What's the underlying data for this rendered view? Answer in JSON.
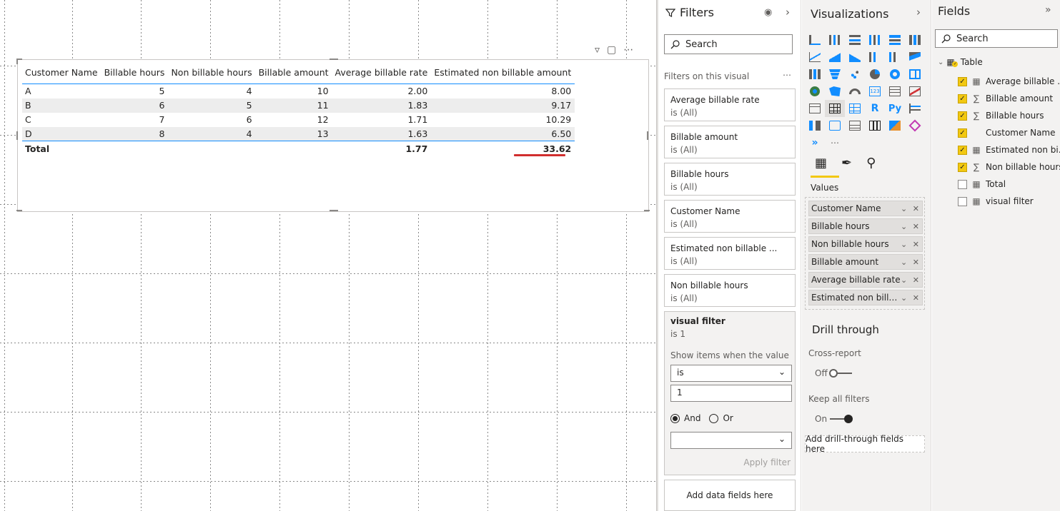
{
  "table": {
    "headers": [
      "Customer Name",
      "Billable hours",
      "Non billable hours",
      "Billable amount",
      "Average billable rate",
      "Estimated non billable amount"
    ],
    "rows": [
      [
        "A",
        "5",
        "4",
        "10",
        "2.00",
        "8.00"
      ],
      [
        "B",
        "6",
        "5",
        "11",
        "1.83",
        "9.17"
      ],
      [
        "C",
        "7",
        "6",
        "12",
        "1.71",
        "10.29"
      ],
      [
        "D",
        "8",
        "4",
        "13",
        "1.63",
        "6.50"
      ]
    ],
    "total": [
      "Total",
      "",
      "",
      "",
      "1.77",
      "33.62"
    ]
  },
  "filters": {
    "title": "Filters",
    "search_placeholder": "Search",
    "section_label": "Filters on this visual",
    "cards": [
      {
        "name": "Average billable rate",
        "state": "is (All)"
      },
      {
        "name": "Billable amount",
        "state": "is (All)"
      },
      {
        "name": "Billable hours",
        "state": "is (All)"
      },
      {
        "name": "Customer Name",
        "state": "is (All)"
      },
      {
        "name": "Estimated non billable ...",
        "state": "is (All)"
      },
      {
        "name": "Non billable hours",
        "state": "is (All)"
      }
    ],
    "visual_filter": {
      "name": "visual filter",
      "state": "is 1",
      "show_label": "Show items when the value",
      "operator": "is",
      "value": "1",
      "and_label": "And",
      "or_label": "Or",
      "apply_label": "Apply filter"
    },
    "add_fields": "Add data fields here"
  },
  "visualizations": {
    "title": "Visualizations",
    "values_label": "Values",
    "wells": [
      "Customer Name",
      "Billable hours",
      "Non billable hours",
      "Billable amount",
      "Average billable rate",
      "Estimated non billabl..."
    ],
    "drill_title": "Drill through",
    "cross_report": "Cross-report",
    "cross_report_state": "Off",
    "keep_filters": "Keep all filters",
    "keep_filters_state": "On",
    "add_drill": "Add drill-through fields here",
    "accent_color": "#f2c811"
  },
  "fields": {
    "title": "Fields",
    "search_placeholder": "Search",
    "table_name": "Table",
    "items": [
      {
        "name": "Average billable ...",
        "checked": true,
        "icon": "calculator"
      },
      {
        "name": "Billable amount",
        "checked": true,
        "icon": "sigma"
      },
      {
        "name": "Billable hours",
        "checked": true,
        "icon": "sigma"
      },
      {
        "name": "Customer Name",
        "checked": true,
        "icon": "none"
      },
      {
        "name": "Estimated non bi...",
        "checked": true,
        "icon": "calculator"
      },
      {
        "name": "Non billable hours",
        "checked": true,
        "icon": "sigma"
      },
      {
        "name": "Total",
        "checked": false,
        "icon": "calculator"
      },
      {
        "name": "visual filter",
        "checked": false,
        "icon": "calculator"
      }
    ]
  }
}
